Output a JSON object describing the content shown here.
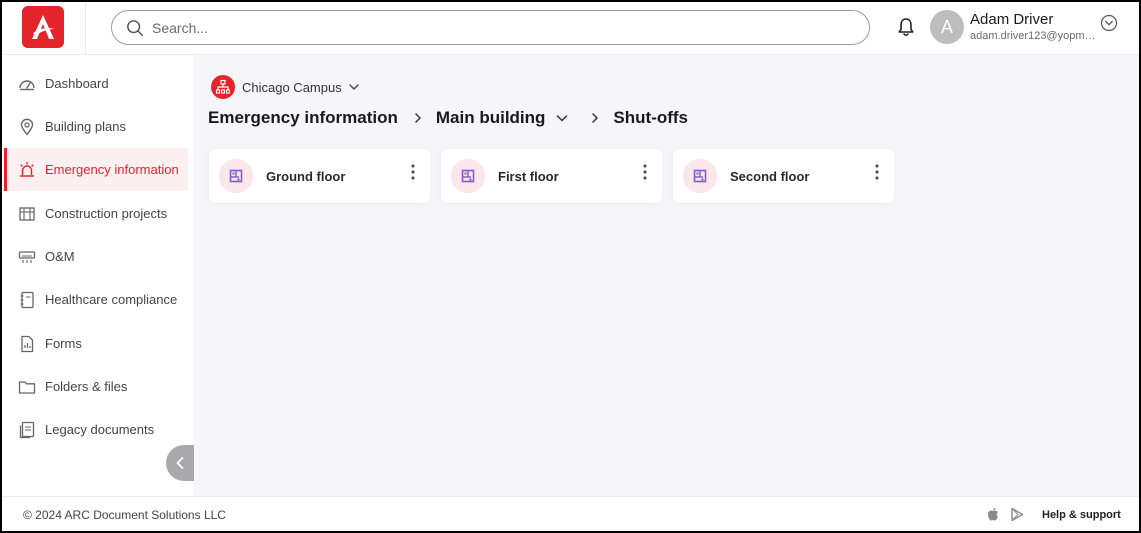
{
  "header": {
    "search_placeholder": "Search...",
    "user_initial": "A",
    "user_name": "Adam Driver",
    "user_email": "adam.driver123@yopmail.com"
  },
  "sidebar": {
    "items": [
      {
        "label": "Dashboard",
        "icon": "dashboard-icon"
      },
      {
        "label": "Building plans",
        "icon": "location-pin-icon"
      },
      {
        "label": "Emergency information",
        "icon": "siren-icon",
        "active": true
      },
      {
        "label": "Construction projects",
        "icon": "construction-icon"
      },
      {
        "label": "O&M",
        "icon": "air-conditioner-icon"
      },
      {
        "label": "Healthcare compliance",
        "icon": "notebook-icon"
      },
      {
        "label": "Forms",
        "icon": "form-icon"
      },
      {
        "label": "Folders & files",
        "icon": "folder-icon"
      },
      {
        "label": "Legacy documents",
        "icon": "documents-icon"
      }
    ]
  },
  "main": {
    "campus": "Chicago Campus",
    "breadcrumb": [
      "Emergency information",
      "Main building",
      "Shut-offs"
    ],
    "cards": [
      {
        "label": "Ground floor"
      },
      {
        "label": "First floor"
      },
      {
        "label": "Second floor"
      }
    ]
  },
  "footer": {
    "copyright": "© 2024 ARC Document Solutions LLC",
    "help": "Help & support"
  },
  "colors": {
    "accent": "#e4242b",
    "card_icon_bg": "#fbe6ea",
    "card_icon": "#7a5ad8",
    "main_bg": "#f6f6f9"
  }
}
